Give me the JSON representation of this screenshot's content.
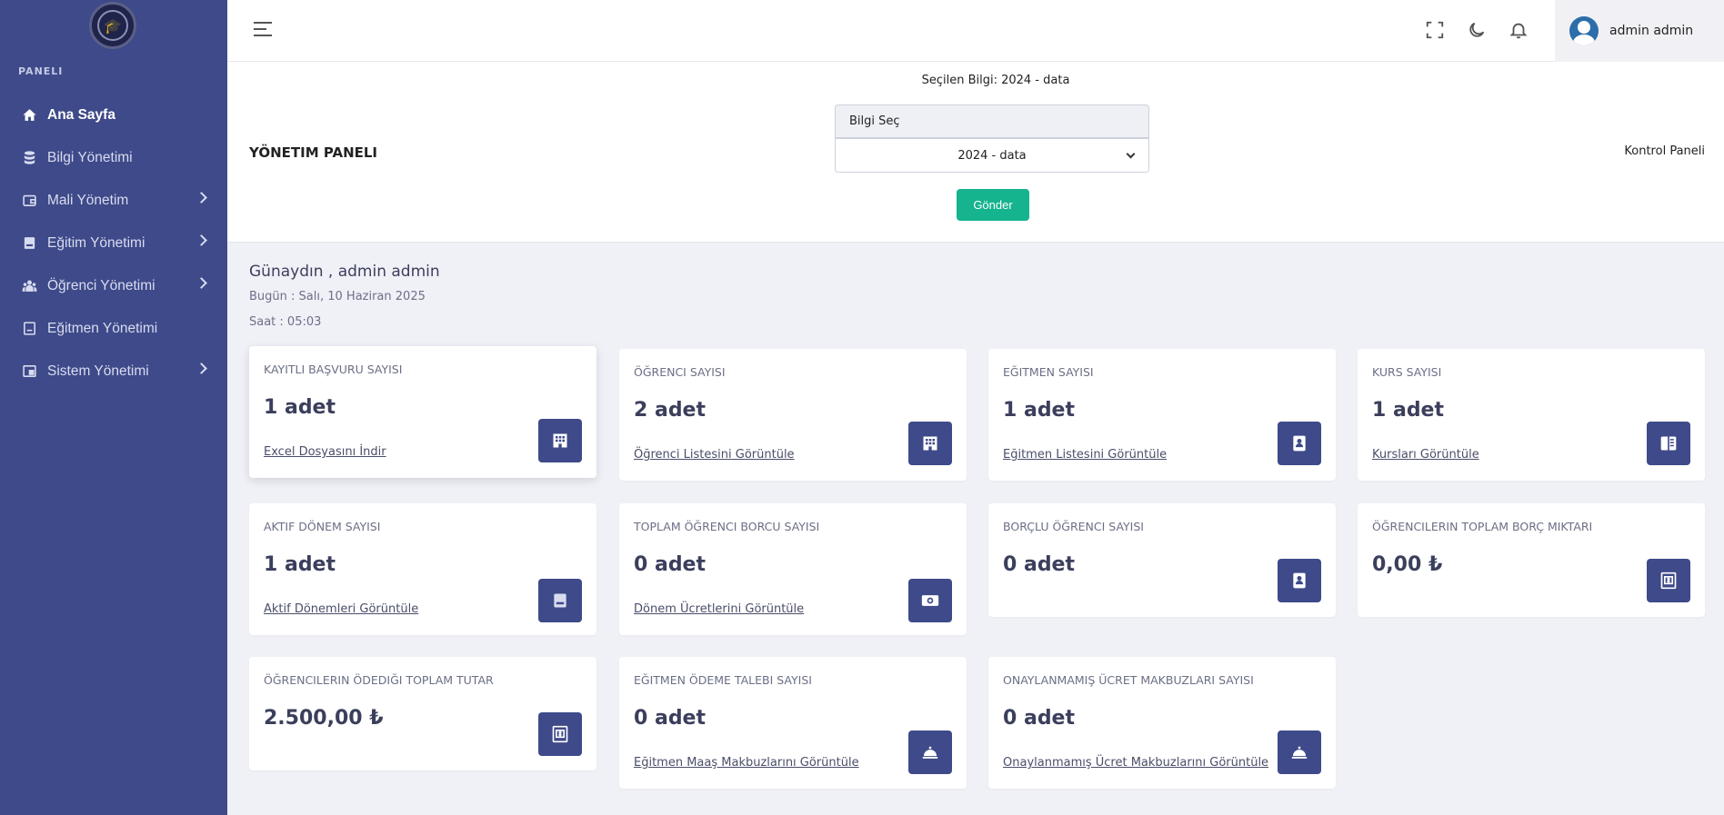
{
  "sidebar": {
    "heading": "PANELI",
    "items": [
      {
        "label": "Ana Sayfa",
        "icon": "home-icon",
        "active": true,
        "submenu": false
      },
      {
        "label": "Bilgi Yönetimi",
        "icon": "database-icon",
        "active": false,
        "submenu": false
      },
      {
        "label": "Mali Yönetim",
        "icon": "wallet-icon",
        "active": false,
        "submenu": true
      },
      {
        "label": "Eğitim Yönetimi",
        "icon": "book-icon",
        "active": false,
        "submenu": true
      },
      {
        "label": "Öğrenci Yönetimi",
        "icon": "users-icon",
        "active": false,
        "submenu": true
      },
      {
        "label": "Eğitmen Yönetimi",
        "icon": "notebook-icon",
        "active": false,
        "submenu": false
      },
      {
        "label": "Sistem Yönetimi",
        "icon": "window-icon",
        "active": false,
        "submenu": true
      }
    ]
  },
  "header": {
    "user_name": "admin admin",
    "icons": [
      "menu-icon",
      "fullscreen-icon",
      "moon-icon",
      "bell-icon"
    ]
  },
  "panel": {
    "title": "YÖNETIM PANELI",
    "selected_info": "Seçilen Bilgi: 2024 - data",
    "label_box": "Bilgi Seç",
    "select_value": "2024 - data",
    "submit_label": "Gönder",
    "breadcrumb": "Kontrol Paneli"
  },
  "greeting": {
    "hello": "Günaydın , admin admin",
    "date": "Bugün : Salı, 10 Haziran 2025",
    "time": "Saat : 05:03"
  },
  "cards": [
    {
      "title": "KAYITLI BAŞVURU SAYISI",
      "value": "1 adet",
      "link": "Excel Dosyasını İndir",
      "icon": "building-icon"
    },
    {
      "title": "ÖĞRENCI SAYISI",
      "value": "2 adet",
      "link": "Öğrenci Listesini Görüntüle",
      "icon": "building-icon"
    },
    {
      "title": "EĞITMEN SAYISI",
      "value": "1 adet",
      "link": "Eğitmen Listesini Görüntüle",
      "icon": "contact-book-icon"
    },
    {
      "title": "KURS SAYISI",
      "value": "1 adet",
      "link": "Kursları Görüntüle",
      "icon": "open-book-icon"
    },
    {
      "title": "AKTIF DÖNEM SAYISI",
      "value": "1 adet",
      "link": "Aktif Dönemleri Görüntüle",
      "icon": "book-icon"
    },
    {
      "title": "TOPLAM ÖĞRENCI BORCU SAYISI",
      "value": "0 adet",
      "link": "Dönem Ücretlerini Görüntüle",
      "icon": "money-icon"
    },
    {
      "title": "BORÇLU ÖĞRENCI SAYISI",
      "value": "0 adet",
      "link": "",
      "icon": "contact-book-icon"
    },
    {
      "title": "ÖĞRENCILERIN TOPLAM BORÇ MIKTARI",
      "value": "0,00 ₺",
      "link": "",
      "icon": "invoice-icon"
    },
    {
      "title": "ÖĞRENCILERIN ÖDEDIĞI TOPLAM TUTAR",
      "value": "2.500,00 ₺",
      "link": "",
      "icon": "invoice-icon"
    },
    {
      "title": "EĞITMEN ÖDEME TALEBI SAYISI",
      "value": "0 adet",
      "link": "Eğitmen Maaş Makbuzlarını Görüntüle",
      "icon": "cloche-icon"
    },
    {
      "title": "ONAYLANMAMIŞ ÜCRET MAKBUZLARI SAYISI",
      "value": "0 adet",
      "link": "Onaylanmamış Ücret Makbuzlarını Görüntüle",
      "icon": "cloche-icon"
    }
  ],
  "colors": {
    "sidebar": "#3e4a89",
    "accent_green": "#15b38e",
    "card_icon_bg": "#3e4a89",
    "page_bg": "#f0f0f7"
  }
}
